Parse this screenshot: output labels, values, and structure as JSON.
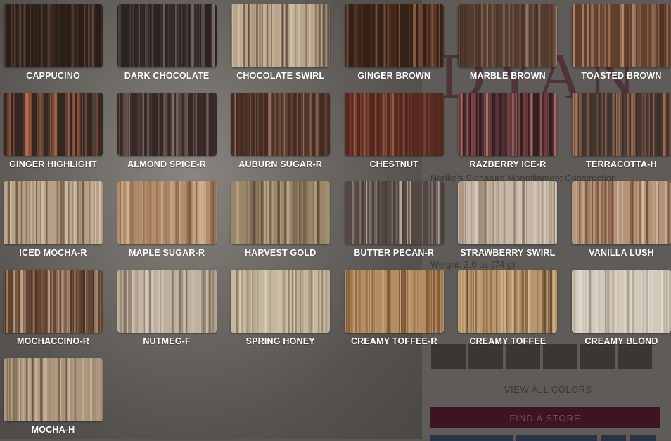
{
  "background_page": {
    "brand": "DYAN",
    "text_lines": [
      "Noriko's Signature Monofilament Construction",
      "Weight: 2.6 oz (74 g)"
    ],
    "view_all_colors": "VIEW ALL COLORS",
    "find_store": "FIND A STORE"
  },
  "swatches": [
    {
      "label": "CAPPUCINO",
      "colors": [
        "#2e211b",
        "#4a3529",
        "#6b5140",
        "#3a2b22"
      ]
    },
    {
      "label": "DARK CHOCOLATE",
      "colors": [
        "#2f2724",
        "#5a4e49",
        "#8b7d76",
        "#3e3431"
      ]
    },
    {
      "label": "CHOCOLATE SWIRL",
      "colors": [
        "#c9b497",
        "#8e7461",
        "#e3d4bc",
        "#5d4a3e"
      ]
    },
    {
      "label": "GINGER BROWN",
      "colors": [
        "#3b2418",
        "#6c4430",
        "#94634a",
        "#4d3022"
      ]
    },
    {
      "label": "MARBLE BROWN",
      "colors": [
        "#5a4034",
        "#8e6b58",
        "#b08d76",
        "#4a3329"
      ]
    },
    {
      "label": "TOASTED BROWN",
      "colors": [
        "#6b4632",
        "#a0735a",
        "#c99b7c",
        "#553628"
      ]
    },
    {
      "label": "GINGER HIGHLIGHT",
      "colors": [
        "#3a2a24",
        "#6c5448",
        "#c37a5a",
        "#9b5a3e"
      ]
    },
    {
      "label": "ALMOND SPICE-R",
      "colors": [
        "#3a2c2a",
        "#6b5650",
        "#8f7872",
        "#4a3a36"
      ]
    },
    {
      "label": "AUBURN SUGAR-R",
      "colors": [
        "#4a3026",
        "#7c5646",
        "#a37a66",
        "#5a3b2f"
      ]
    },
    {
      "label": "CHESTNUT",
      "colors": [
        "#5a2c22",
        "#8b4a3a",
        "#b06a55",
        "#6a342a"
      ]
    },
    {
      "label": "RAZBERRY ICE-R",
      "colors": [
        "#3a2226",
        "#6a4248",
        "#c27a72",
        "#8a4e4c"
      ]
    },
    {
      "label": "TERRACOTTA-H",
      "colors": [
        "#4a3a34",
        "#8a6652",
        "#c08564",
        "#3a2e2a"
      ]
    },
    {
      "label": "ICED MOCHA-R",
      "colors": [
        "#c6ae92",
        "#9a806a",
        "#e2d2bb",
        "#7a624f"
      ]
    },
    {
      "label": "MAPLE SUGAR-R",
      "colors": [
        "#c49a76",
        "#a77e5e",
        "#e3c6a4",
        "#8a6348"
      ]
    },
    {
      "label": "HARVEST GOLD",
      "colors": [
        "#a89272",
        "#7e6a52",
        "#cdb899",
        "#5e4e3c"
      ]
    },
    {
      "label": "BUTTER PECAN-R",
      "colors": [
        "#5a4e48",
        "#8e807a",
        "#c9b8a6",
        "#463c38"
      ]
    },
    {
      "label": "STRAWBERRY SWIRL",
      "colors": [
        "#d8c7b6",
        "#b49b86",
        "#ece2d6",
        "#9c8470"
      ]
    },
    {
      "label": "VANILLA LUSH",
      "colors": [
        "#c4a082",
        "#9a6e52",
        "#e3cbb3",
        "#7a4e36"
      ]
    },
    {
      "label": "MOCHACCINO-R",
      "colors": [
        "#6a4a38",
        "#a07a5e",
        "#d0b294",
        "#4e3426"
      ]
    },
    {
      "label": "NUTMEG-F",
      "colors": [
        "#d0c0ae",
        "#a8957f",
        "#e8ddd0",
        "#8a7562"
      ]
    },
    {
      "label": "SPRING HONEY",
      "colors": [
        "#d6c7ae",
        "#b8a384",
        "#ece2d0",
        "#9c8668"
      ]
    },
    {
      "label": "CREAMY TOFFEE-R",
      "colors": [
        "#c49a6c",
        "#a07448",
        "#e2c498",
        "#7e5434"
      ]
    },
    {
      "label": "CREAMY TOFFEE",
      "colors": [
        "#c9a478",
        "#9c7448",
        "#e6cba0",
        "#6e4e30"
      ]
    },
    {
      "label": "CREAMY BLOND",
      "colors": [
        "#e4dacb",
        "#cbbca6",
        "#f3ede3",
        "#b0a08a"
      ]
    },
    {
      "label": "MOCHA-H",
      "colors": [
        "#bca588",
        "#8e765e",
        "#dccab0",
        "#6e5844"
      ]
    }
  ]
}
